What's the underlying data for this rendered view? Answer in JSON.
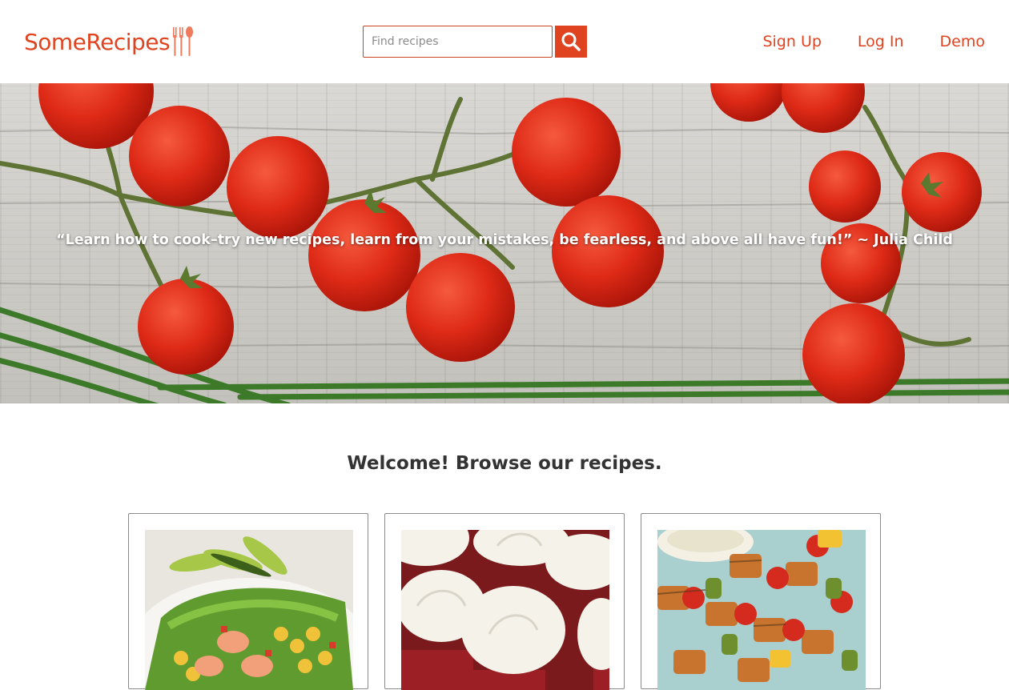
{
  "header": {
    "logo_text": "SomeRecipes",
    "logo_icon": "fork-spoon-icon",
    "search": {
      "placeholder": "Find recipes",
      "value": "",
      "button_icon": "search-icon"
    },
    "nav": [
      {
        "label": "Sign Up"
      },
      {
        "label": "Log In"
      },
      {
        "label": "Demo"
      }
    ]
  },
  "hero": {
    "quote": "“Learn how to cook–try new recipes, learn from your mistakes, be fearless, and above all have fun!” ~ Julia Child"
  },
  "main": {
    "welcome": "Welcome! Browse our recipes."
  },
  "recipes": [
    {
      "image": "shrimp-corn-avocado-salad"
    },
    {
      "image": "red-velvet-cupcakes"
    },
    {
      "image": "grilled-vegetable-skewers"
    }
  ],
  "colors": {
    "brand": "#e0431f",
    "text": "#333333",
    "card_border": "#8a8a8a"
  }
}
